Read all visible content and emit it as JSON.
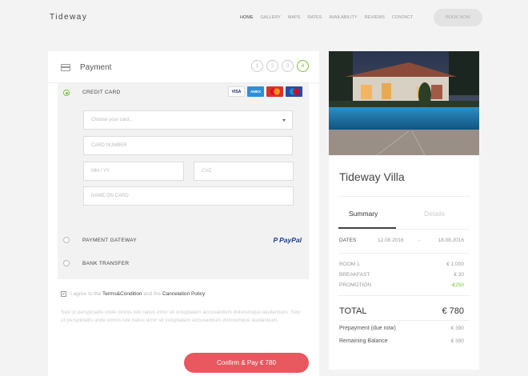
{
  "header": {
    "brand": "Tideway",
    "nav": [
      "HOME",
      "GALLERY",
      "MAPS",
      "RATES",
      "AVAILABILITY",
      "REVIEWS",
      "CONTACT"
    ],
    "book_label": "BOOK NOW"
  },
  "payment": {
    "title": "Payment",
    "steps": [
      "1",
      "2",
      "3",
      "4"
    ],
    "active_step": 4,
    "credit_card": {
      "label": "CREDIT CARD",
      "selected": true,
      "logos": [
        "VISA",
        "AMEX",
        "MasterCard",
        "Maestro"
      ],
      "select_placeholder": "Choose your card...",
      "card_number_placeholder": "CARD NUMBER",
      "expiry_placeholder": "MM / YY",
      "cvc_placeholder": "CVC",
      "name_placeholder": "NAME ON CARD"
    },
    "gateway": {
      "label": "PAYMENT GATEWAY",
      "logo": "PayPal"
    },
    "bank": {
      "label": "BANK TRANSFER"
    },
    "agree": {
      "prefix": "I agree to the",
      "terms": "Terms&Condition",
      "middle": "and the",
      "policy": "Cancelation Policy"
    },
    "lorem": "Sed ut perspiciatis unde omnis iste natus error sit voluptatem accusantium doloremque laudantium. Sed ut perspiciatis unde omnis iste natus error sit voluptatem accusantium doloremque laudantium.",
    "confirm_label": "Confirm & Pay € 780"
  },
  "summary": {
    "villa": "Tideway Villa",
    "tabs": {
      "summary": "Summary",
      "details": "Details"
    },
    "dates": {
      "label": "DATES",
      "from": "12.08.2016",
      "sep": "-",
      "to": "18.08.2016"
    },
    "items": [
      {
        "label": "ROOM 1",
        "value": "€ 1.000"
      },
      {
        "label": "BREAKFAST",
        "value": "€ 30"
      },
      {
        "label": "PROMOTION",
        "value": "-€250"
      }
    ],
    "total": {
      "label": "TOTAL",
      "value": "€ 780"
    },
    "prepayment": {
      "label": "Prepayment (due now)",
      "value": "€ 390"
    },
    "remaining": {
      "label": "Remaining Balance",
      "value": "€ 390"
    }
  },
  "colors": {
    "accent_green": "#7bbf3a",
    "confirm_red": "#e8585f",
    "paypal_blue": "#1a3d8f"
  }
}
